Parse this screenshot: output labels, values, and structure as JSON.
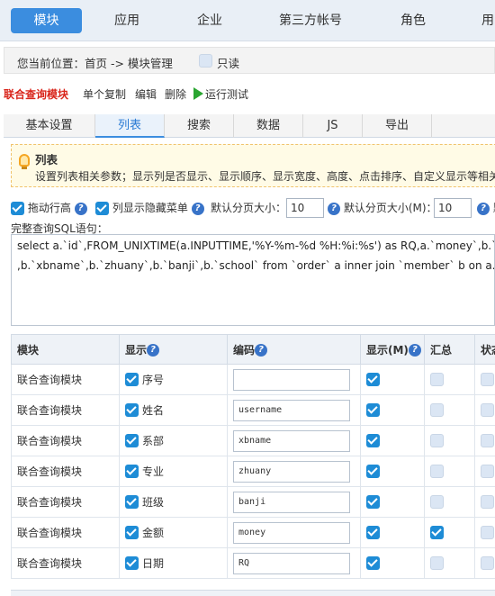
{
  "nav": {
    "items": [
      {
        "label": "模块"
      },
      {
        "label": "应用"
      },
      {
        "label": "企业"
      },
      {
        "label": "第三方帐号"
      },
      {
        "label": "角色"
      },
      {
        "label": "用"
      }
    ]
  },
  "breadcrumb": {
    "text": "您当前位置：首页 -> 模块管理",
    "readonly_label": "只读"
  },
  "toolbar": {
    "title": "联合查询模块",
    "copy": "单个复制",
    "edit": "编辑",
    "delete": "删除",
    "run": "运行测试"
  },
  "tabs": [
    "基本设置",
    "列表",
    "搜索",
    "数据",
    "JS",
    "导出"
  ],
  "tip": {
    "title": "列表",
    "text": "设置列表相关参数；显示列是否显示、显示顺序、显示宽度、高度、点击排序、自定义显示等相关"
  },
  "options": {
    "drag_label": "拖动行高",
    "hide_menu_label": "列显示隐藏菜单",
    "page_size_label": "默认分页大小：",
    "page_size_value": "10",
    "page_size_m_label": "默认分页大小(M)：",
    "page_size_m_value": "10",
    "more_label": "默"
  },
  "sql": {
    "label": "完整查询SQL语句：",
    "line1": "select a.`id`,FROM_UNIXTIME(a.INPUTTIME,'%Y-%m-%d %H:%i:%s') as RQ,a.`money`,b.`userid`,",
    "line2": ",b.`xbname`,b.`zhuany`,b.`banji`,b.`school` from `order` a inner join `member` b on a.`vcard`=b.`vca"
  },
  "table": {
    "headers": {
      "module": "模块",
      "show": "显示",
      "code": "编码",
      "show_m": "显示(M)",
      "summary": "汇总",
      "state": "状态"
    },
    "rows": [
      {
        "module": "联合查询模块",
        "label": "序号",
        "code": "",
        "show_m": true,
        "summary": false
      },
      {
        "module": "联合查询模块",
        "label": "姓名",
        "code": "username",
        "show_m": true,
        "summary": false
      },
      {
        "module": "联合查询模块",
        "label": "系部",
        "code": "xbname",
        "show_m": true,
        "summary": false
      },
      {
        "module": "联合查询模块",
        "label": "专业",
        "code": "zhuany",
        "show_m": true,
        "summary": false
      },
      {
        "module": "联合查询模块",
        "label": "班级",
        "code": "banji",
        "show_m": true,
        "summary": false
      },
      {
        "module": "联合查询模块",
        "label": "金额",
        "code": "money",
        "show_m": true,
        "summary": true
      },
      {
        "module": "联合查询模块",
        "label": "日期",
        "code": "RQ",
        "show_m": true,
        "summary": false
      }
    ]
  },
  "colors": {
    "accent": "#3b8ddf",
    "check": "#1e8cd6",
    "title_red": "#d9261c",
    "run_green": "#2aa531"
  },
  "icons": {
    "help": "help-circle-icon",
    "checkbox": "checkbox-icon",
    "bulb": "lightbulb-icon",
    "play": "play-icon"
  }
}
